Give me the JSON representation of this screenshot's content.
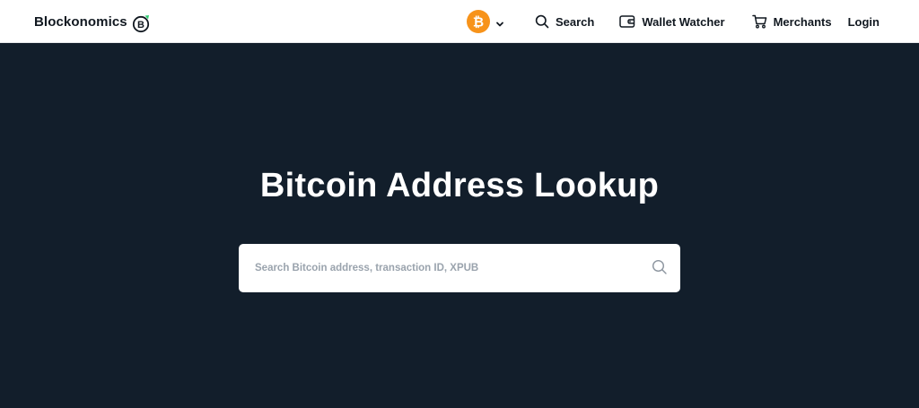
{
  "header": {
    "logo_text": "Blockonomics",
    "logo_letter": "B",
    "coin_letter": "₿",
    "nav": {
      "search_label": "Search",
      "wallet_watcher_label": "Wallet Watcher",
      "merchants_label": "Merchants",
      "login_label": "Login"
    }
  },
  "hero": {
    "title": "Bitcoin Address Lookup",
    "search_placeholder": "Search Bitcoin address, transaction ID, XPUB",
    "search_value": ""
  },
  "colors": {
    "hero_background": "#121e2b",
    "bitcoin_orange": "#f7931a",
    "logo_accent_green": "#2ecc71",
    "text_dark": "#111820"
  },
  "icons": {
    "coin": "bitcoin-icon",
    "coin_dropdown": "chevron-down-icon",
    "search": "search-icon",
    "wallet": "wallet-icon",
    "merchants": "cart-icon",
    "search_submit": "search-icon"
  }
}
